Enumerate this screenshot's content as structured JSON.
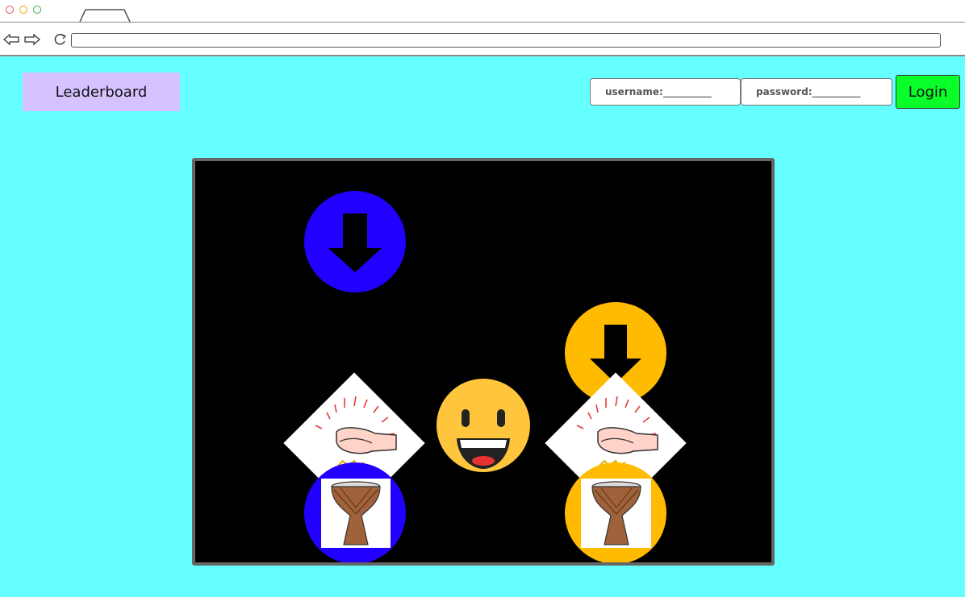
{
  "browser": {
    "address_value": ""
  },
  "header": {
    "leaderboard_label": "Leaderboard",
    "username_label": "username:__________",
    "password_label": "password:__________",
    "login_label": "Login"
  },
  "game": {
    "lanes": [
      {
        "name": "blue-lane",
        "color": "#2200ff",
        "drum_image": "djembe-drum",
        "hit_image": "clapping-hands"
      },
      {
        "name": "yellow-lane",
        "color": "#ffbb00",
        "drum_image": "djembe-drum",
        "hit_image": "clapping-hands"
      }
    ],
    "notes": [
      {
        "lane": "blue-lane",
        "icon": "down-arrow-icon"
      },
      {
        "lane": "yellow-lane",
        "icon": "down-arrow-icon"
      }
    ],
    "center_face": "grinning-face-icon"
  }
}
